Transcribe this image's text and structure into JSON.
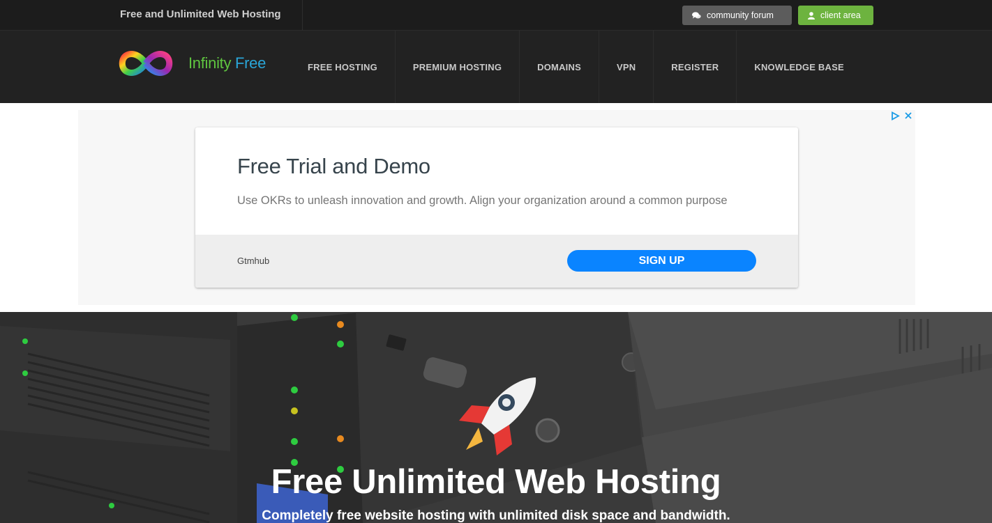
{
  "topbar": {
    "tagline": "Free and Unlimited Web Hosting",
    "forum_label": "community forum",
    "client_label": "client area"
  },
  "logo": {
    "part1": "Infinity",
    "part2": "Free"
  },
  "nav": {
    "items": [
      "FREE HOSTING",
      "PREMIUM HOSTING",
      "DOMAINS",
      "VPN",
      "REGISTER",
      "KNOWLEDGE BASE"
    ]
  },
  "ad": {
    "title": "Free Trial and Demo",
    "description": "Use OKRs to unleash innovation and growth. Align your organization around a common purpose",
    "advertiser": "Gtmhub",
    "cta": "SIGN UP"
  },
  "hero": {
    "title": "Free Unlimited Web Hosting",
    "subtitle": "Completely free website hosting with unlimited disk space and bandwidth."
  },
  "colors": {
    "topbar_bg": "#1c1c1c",
    "nav_bg": "#222222",
    "client_btn": "#6db33f",
    "forum_btn": "#5c5c5c",
    "ad_cta": "#0a84ff"
  }
}
